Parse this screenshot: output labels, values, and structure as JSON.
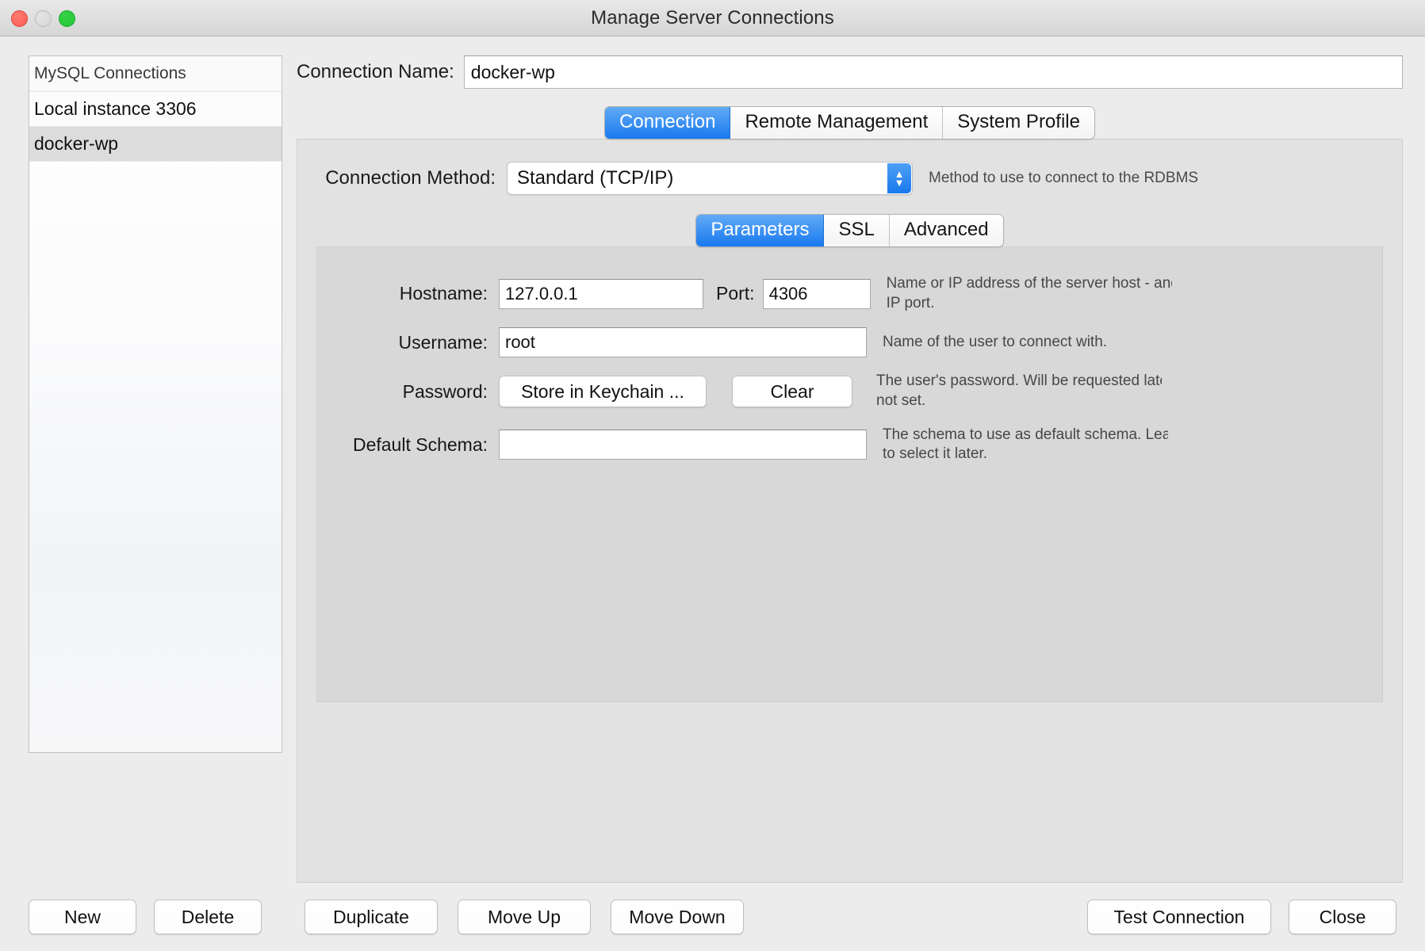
{
  "window": {
    "title": "Manage Server Connections",
    "traffic_lights": [
      "close",
      "minimize",
      "maximize"
    ]
  },
  "sidebar": {
    "header": "MySQL Connections",
    "items": [
      {
        "label": "Local instance 3306",
        "selected": false
      },
      {
        "label": "docker-wp",
        "selected": true
      }
    ]
  },
  "connection_name": {
    "label": "Connection Name:",
    "value": "docker-wp"
  },
  "main_tabs": [
    {
      "label": "Connection",
      "active": true
    },
    {
      "label": "Remote Management",
      "active": false
    },
    {
      "label": "System Profile",
      "active": false
    }
  ],
  "connection_method": {
    "label": "Connection Method:",
    "value": "Standard (TCP/IP)",
    "hint": "Method to use to connect to the RDBMS"
  },
  "param_tabs": [
    {
      "label": "Parameters",
      "active": true
    },
    {
      "label": "SSL",
      "active": false
    },
    {
      "label": "Advanced",
      "active": false
    }
  ],
  "parameters": {
    "hostname": {
      "label": "Hostname:",
      "value": "127.0.0.1",
      "hint_line1": "Name or IP address of the server host - and",
      "hint_line2": "IP port."
    },
    "port": {
      "label": "Port:",
      "value": "4306"
    },
    "username": {
      "label": "Username:",
      "value": "root",
      "hint_line1": "Name of the user to connect with.",
      "hint_line2": ""
    },
    "password": {
      "label": "Password:",
      "store_button": "Store in Keychain ...",
      "clear_button": "Clear",
      "hint_line1": "The user's password. Will be requested late",
      "hint_line2": "not set."
    },
    "default_schema": {
      "label": "Default Schema:",
      "value": "",
      "placeholder": "",
      "hint_line1": "The schema to use as default schema. Leav",
      "hint_line2": "to select it later."
    }
  },
  "footer": {
    "new": "New",
    "delete": "Delete",
    "duplicate": "Duplicate",
    "move_up": "Move Up",
    "move_down": "Move Down",
    "test_connection": "Test Connection",
    "close": "Close"
  },
  "colors": {
    "accent_blue": "#1878ee",
    "window_bg": "#ececec",
    "panel_bg": "#e2e2e2",
    "inner_panel_bg": "#d8d8d8",
    "selection_gray": "#dcdcdc",
    "traffic_close": "#fd5c55",
    "traffic_min": "#d5d5d5",
    "traffic_max": "#23c734"
  }
}
